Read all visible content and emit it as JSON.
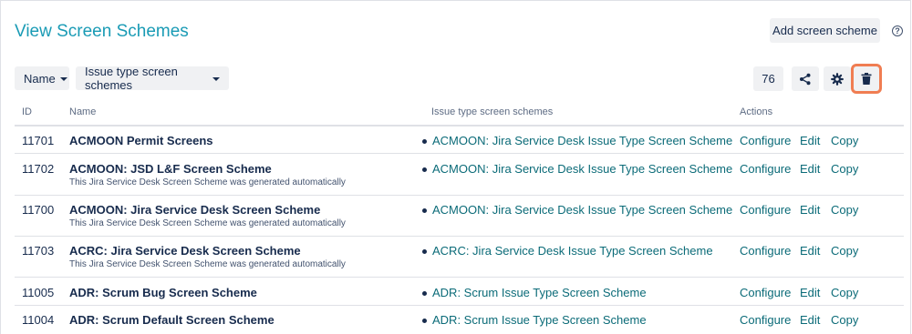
{
  "header": {
    "title": "View Screen Schemes",
    "add_button": "Add screen scheme",
    "help_icon": "?"
  },
  "toolbar": {
    "filter_name": "Name",
    "filter_its": "Issue type screen schemes",
    "count": "76",
    "icons": [
      "share-icon",
      "gear-icon",
      "trash-icon"
    ],
    "highlight_color": "#f07d52"
  },
  "table": {
    "columns": [
      "ID",
      "Name",
      "Issue type screen schemes",
      "Actions"
    ],
    "actions": {
      "configure": "Configure",
      "edit": "Edit",
      "copy": "Copy"
    },
    "rows": [
      {
        "id": "11701",
        "name": "ACMOON Permit Screens",
        "desc": "",
        "its": "ACMOON: Jira Service Desk Issue Type Screen Scheme"
      },
      {
        "id": "11702",
        "name": "ACMOON: JSD L&F Screen Scheme",
        "desc": "This Jira Service Desk Screen Scheme was generated automatically",
        "its": "ACMOON: Jira Service Desk Issue Type Screen Scheme"
      },
      {
        "id": "11700",
        "name": "ACMOON: Jira Service Desk Screen Scheme",
        "desc": "This Jira Service Desk Screen Scheme was generated automatically",
        "its": "ACMOON: Jira Service Desk Issue Type Screen Scheme"
      },
      {
        "id": "11703",
        "name": "ACRC: Jira Service Desk Screen Scheme",
        "desc": "This Jira Service Desk Screen Scheme was generated automatically",
        "its": "ACRC: Jira Service Desk Issue Type Screen Scheme"
      },
      {
        "id": "11005",
        "name": "ADR: Scrum Bug Screen Scheme",
        "desc": "",
        "its": "ADR: Scrum Issue Type Screen Scheme"
      },
      {
        "id": "11004",
        "name": "ADR: Scrum Default Screen Scheme",
        "desc": "",
        "its": "ADR: Scrum Issue Type Screen Scheme"
      }
    ]
  }
}
